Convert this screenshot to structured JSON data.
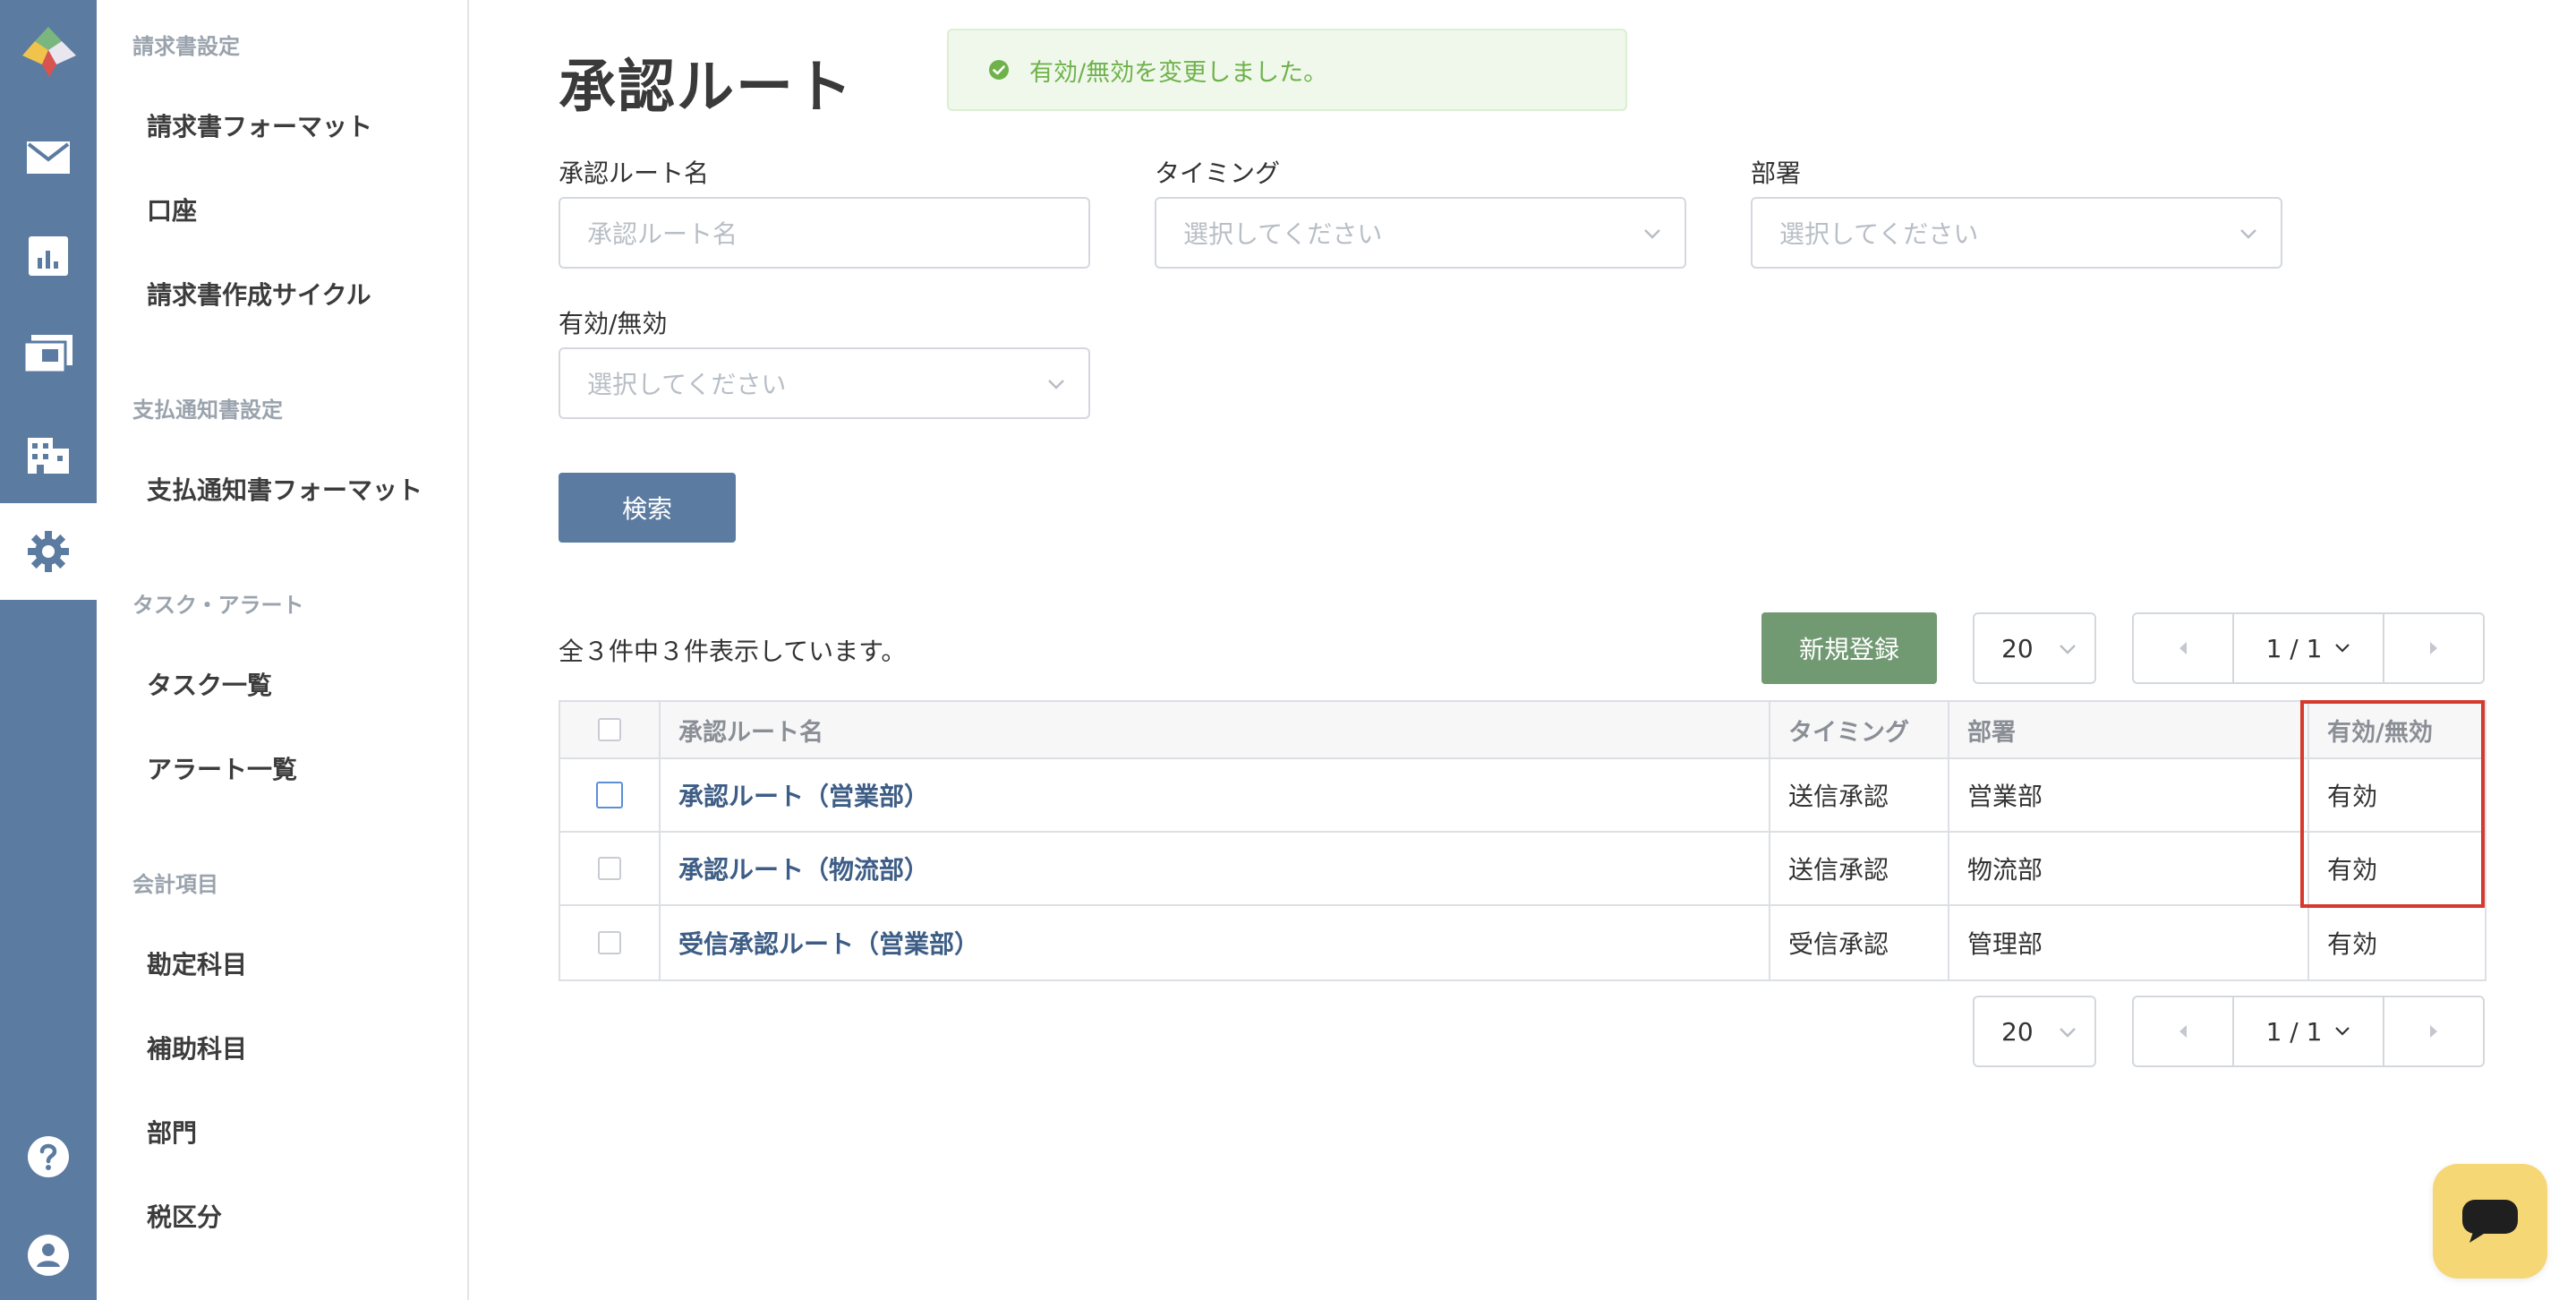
{
  "rail": {
    "items": [
      {
        "icon": "logo-icon"
      },
      {
        "icon": "mail-icon"
      },
      {
        "icon": "chart-icon"
      },
      {
        "icon": "payment-icon"
      },
      {
        "icon": "building-icon"
      },
      {
        "icon": "gear-icon",
        "active": true
      },
      {
        "icon": "help-icon"
      },
      {
        "icon": "user-icon"
      }
    ]
  },
  "sidebar": {
    "sections": [
      {
        "heading": "請求書設定",
        "items": [
          "請求書フォーマット",
          "口座",
          "請求書作成サイクル"
        ]
      },
      {
        "heading": "支払通知書設定",
        "items": [
          "支払通知書フォーマット"
        ]
      },
      {
        "heading": "タスク・アラート",
        "items": [
          "タスク一覧",
          "アラート一覧"
        ]
      },
      {
        "heading": "会計項目",
        "items": [
          "勘定科目",
          "補助科目",
          "部門",
          "税区分"
        ]
      }
    ]
  },
  "page": {
    "title": "承認ルート",
    "toast": "有効/無効を変更しました。",
    "toast_color": "#6fb24c"
  },
  "filters": {
    "route_name": {
      "label": "承認ルート名",
      "placeholder": "承認ルート名"
    },
    "timing": {
      "label": "タイミング",
      "placeholder": "選択してください"
    },
    "department": {
      "label": "部署",
      "placeholder": "選択してください"
    },
    "valid": {
      "label": "有効/無効",
      "placeholder": "選択してください"
    },
    "search_label": "検索"
  },
  "list": {
    "count_text": "全３件中３件表示しています。",
    "new_label": "新規登録",
    "per_page": "20",
    "page_indicator": "1 / 1",
    "columns": [
      "承認ルート名",
      "タイミング",
      "部署",
      "有効/無効"
    ],
    "rows": [
      {
        "name": "承認ルート（営業部）",
        "timing": "送信承認",
        "dept": "営業部",
        "valid": "有効"
      },
      {
        "name": "承認ルート（物流部）",
        "timing": "送信承認",
        "dept": "物流部",
        "valid": "有効"
      },
      {
        "name": "受信承認ルート（営業部）",
        "timing": "受信承認",
        "dept": "管理部",
        "valid": "有効"
      }
    ]
  },
  "colors": {
    "rail": "#5c7ba1",
    "primary_button": "#5c7ba1",
    "new_button": "#719a72",
    "link": "#3d5d86",
    "highlight": "#d63a2f",
    "chat": "#f6d776"
  }
}
